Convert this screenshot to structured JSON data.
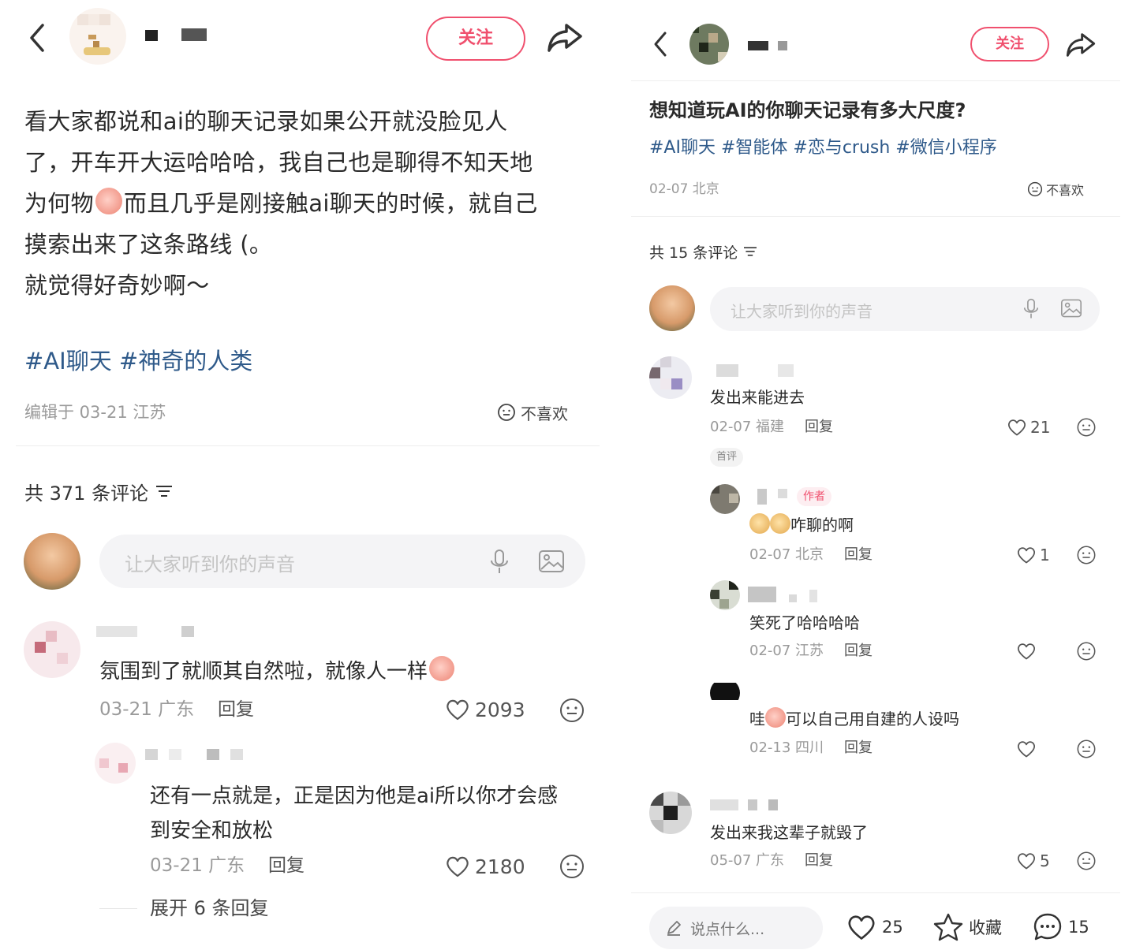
{
  "left": {
    "follow_label": "关注",
    "post_line1": "看大家都说和ai的聊天记录如果公开就没脸见人",
    "post_line2": "了，开车开大运哈哈哈，我自己也是聊得不知天地",
    "post_line3a": "为何物",
    "post_line3b": "而且几乎是刚接触ai聊天的时候，就自己",
    "post_line4": "摸索出来了这条路线 (。",
    "post_line5": "就觉得好奇妙啊～",
    "tags": "#AI聊天 #神奇的人类",
    "edited": "编辑于 03-21 江苏",
    "dislike": "不喜欢",
    "comment_count": "共 371 条评论",
    "input_placeholder": "让大家听到你的声音",
    "comments": [
      {
        "text": "氛围到了就顺其自然啦，就像人一样",
        "date": "03-21 广东",
        "reply": "回复",
        "likes": "2093"
      },
      {
        "text_line1": "还有一点就是，正是因为他是ai所以你才会感",
        "text_line2": "到安全和放松",
        "date": "03-21 广东",
        "reply": "回复",
        "likes": "2180"
      }
    ],
    "expand": "展开 6 条回复"
  },
  "right": {
    "follow_label": "关注",
    "title": "想知道玩AI的你聊天记录有多大尺度?",
    "tags": "#AI聊天 #智能体 #恋与crush #微信小程序",
    "date": "02-07 北京",
    "dislike": "不喜欢",
    "comment_count": "共 15 条评论",
    "input_placeholder": "让大家听到你的声音",
    "c1": {
      "text": "发出来能进去",
      "date": "02-07 福建",
      "reply": "回复",
      "likes": "21",
      "badge": "首评"
    },
    "c2": {
      "author_badge": "作者",
      "text": "咋聊的啊",
      "date": "02-07 北京",
      "reply": "回复",
      "likes": "1"
    },
    "c3": {
      "text": "笑死了哈哈哈哈",
      "date": "02-07 江苏",
      "reply": "回复"
    },
    "c4": {
      "text_a": "哇",
      "text_b": "可以自己用自建的人设吗",
      "date": "02-13 四川",
      "reply": "回复"
    },
    "c5": {
      "text": "发出来我这辈子就毁了",
      "date": "05-07 广东",
      "reply": "回复",
      "likes": "5"
    },
    "bottom": {
      "say": "说点什么...",
      "likes": "25",
      "collect": "收藏",
      "comments": "15"
    }
  }
}
